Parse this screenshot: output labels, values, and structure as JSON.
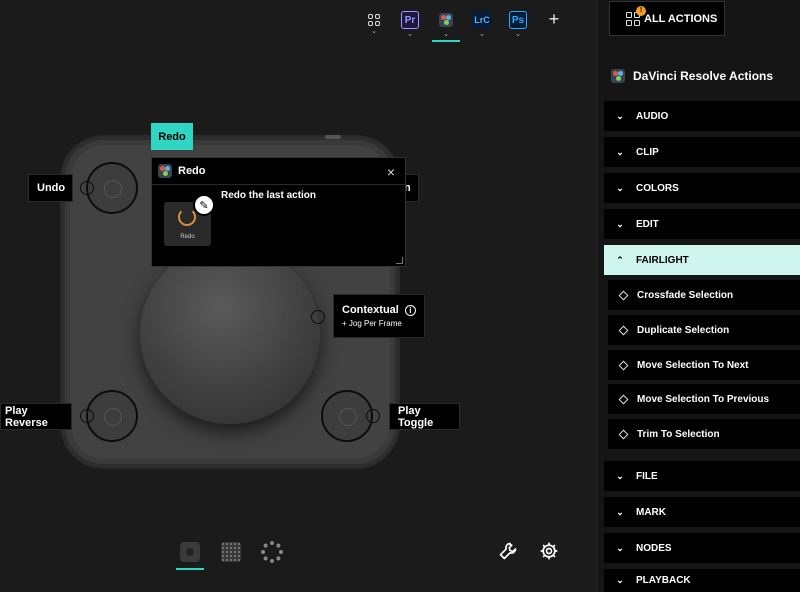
{
  "app_bar": {
    "apps": [
      {
        "name": "all-apps",
        "label": ""
      },
      {
        "name": "premiere-pro",
        "label": "Pr",
        "color": "#9999ff",
        "bg": "#1f1640"
      },
      {
        "name": "davinci-resolve",
        "label": "",
        "active": true
      },
      {
        "name": "lightroom-classic",
        "label": "LrC",
        "color": "#4fb3ff",
        "bg": "#0b1b33"
      },
      {
        "name": "photoshop",
        "label": "Ps",
        "color": "#31a8ff",
        "bg": "#001e36"
      }
    ],
    "add_label": "+"
  },
  "callouts": {
    "redo_tag": "Redo",
    "undo": "Undo",
    "play_reverse": "Play Reverse",
    "play_toggle": "Play Toggle",
    "contextual_title": "Contextual",
    "contextual_sub": "+ Jog Per Frame",
    "hidden_partial": "n"
  },
  "popup": {
    "title": "Redo",
    "description": "Redo the last action",
    "tile_label": "Redo",
    "close": "×"
  },
  "panel": {
    "all_actions_label": "ALL ACTIONS",
    "badge": "!",
    "title": "DaVinci Resolve Actions",
    "categories_top": [
      {
        "label": "AUDIO",
        "chev": "⌄"
      },
      {
        "label": "CLIP",
        "chev": "⌄"
      },
      {
        "label": "COLORS",
        "chev": "⌄"
      },
      {
        "label": "EDIT",
        "chev": "⌄"
      },
      {
        "label": "FAIRLIGHT",
        "chev": "⌃"
      }
    ],
    "fairlight_items": [
      {
        "label": "Crossfade Selection"
      },
      {
        "label": "Duplicate Selection"
      },
      {
        "label": "Move Selection To Next"
      },
      {
        "label": "Move Selection To Previous"
      },
      {
        "label": "Trim To Selection"
      }
    ],
    "categories_bottom": [
      {
        "label": "FILE",
        "chev": "⌄"
      },
      {
        "label": "MARK",
        "chev": "⌄"
      },
      {
        "label": "NODES",
        "chev": "⌄"
      },
      {
        "label": "PLAYBACK",
        "chev": "⌄"
      }
    ]
  },
  "colors": {
    "accent": "#2fd6c3",
    "open_category_bg": "#cff5ef"
  }
}
